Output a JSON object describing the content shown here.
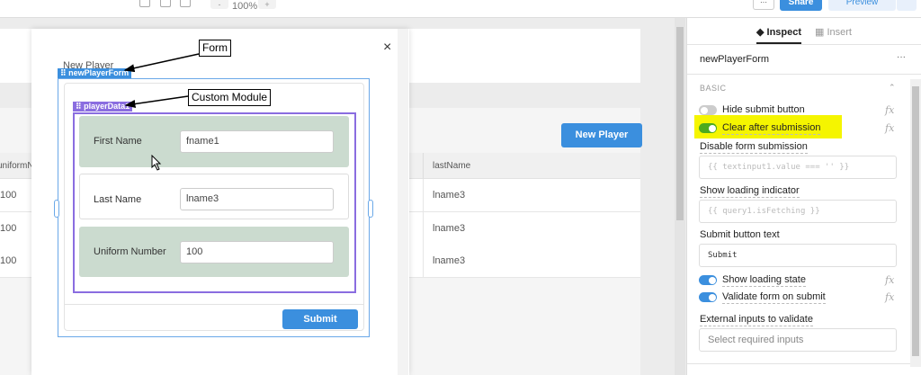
{
  "toolbar": {
    "zoom_minus": "-",
    "zoom_level": "100%",
    "zoom_plus": "+",
    "more": "···",
    "share": "Share",
    "preview": "Preview"
  },
  "table": {
    "columns": [
      "uniformN",
      "lastName"
    ],
    "rows": [
      [
        "100",
        "lname3"
      ],
      [
        "100",
        "lname3"
      ],
      [
        "100",
        "lname3"
      ]
    ],
    "new_player_button": "New Player"
  },
  "modal": {
    "title": "New Player",
    "close": "×",
    "form_tag": "newPlayerForm",
    "module_tag": "playerData1",
    "fields": [
      {
        "label": "First Name",
        "value": "fname1"
      },
      {
        "label": "Last Name",
        "value": "lname3"
      },
      {
        "label": "Uniform Number",
        "value": "100"
      }
    ],
    "submit": "Submit"
  },
  "annotations": {
    "form": "Form",
    "module": "Custom Module"
  },
  "panel": {
    "tabs": [
      {
        "label": "Inspect",
        "active": true
      },
      {
        "label": "Insert",
        "active": false
      }
    ],
    "component": "newPlayerForm",
    "menu": "···",
    "section": "BASIC",
    "hide_submit": {
      "label": "Hide submit button",
      "on": false
    },
    "clear_after": {
      "label": "Clear after submission",
      "on": true,
      "highlight": "#f5f500"
    },
    "disable_label": "Disable form submission",
    "disable_placeholder": "{{ textinput1.value === '' }}",
    "loading_label": "Show loading indicator",
    "loading_placeholder": "{{ query1.isFetching }}",
    "submit_text_label": "Submit button text",
    "submit_text_value": "Submit",
    "show_loading": {
      "label": "Show loading state",
      "on": true
    },
    "validate": {
      "label": "Validate form on submit",
      "on": true
    },
    "external_label": "External inputs to validate",
    "external_placeholder": "Select required inputs",
    "fx": "fx"
  },
  "colors": {
    "accent": "#3b8fde",
    "form_tag": "#3b8fde",
    "module_tag": "#8a6de0",
    "toggle_green": "#4caa1e"
  }
}
